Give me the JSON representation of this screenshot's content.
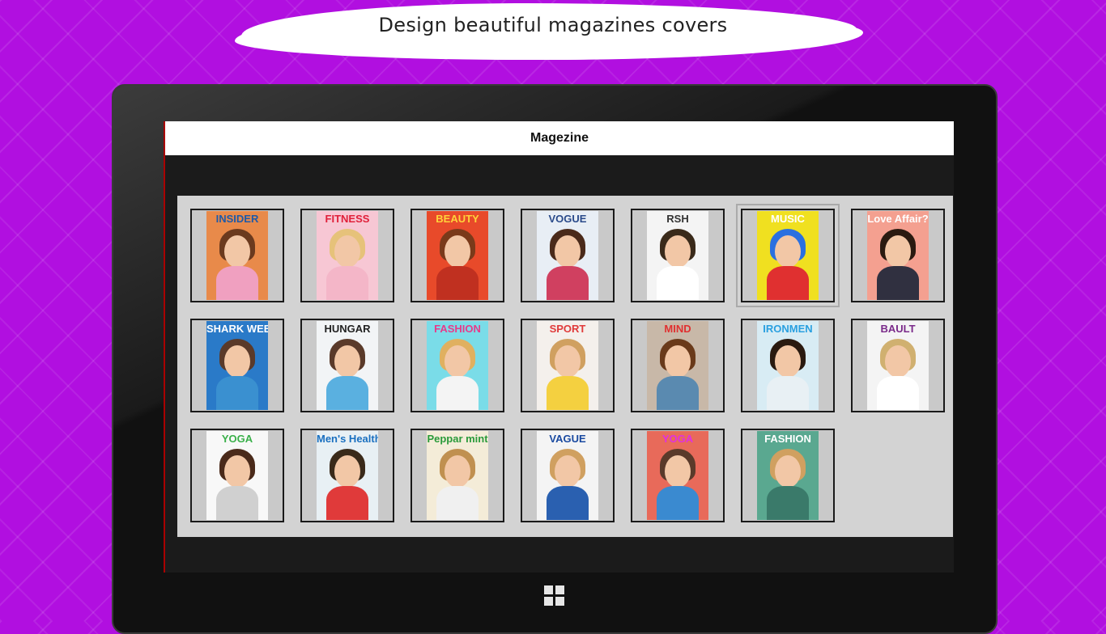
{
  "banner": {
    "text": "Design beautiful magazines covers"
  },
  "app": {
    "title": "Magezine"
  },
  "covers": [
    {
      "title": "INSIDER",
      "bg": "#e88a4a",
      "title_color": "#1e5aa8",
      "hair": "#6b3a1e",
      "cloth": "#f0a0c0"
    },
    {
      "title": "FITNESS",
      "bg": "#f7c7d4",
      "title_color": "#e0203a",
      "hair": "#e6c27a",
      "cloth": "#f4b6c8"
    },
    {
      "title": "BEAUTY",
      "bg": "#e84a2a",
      "title_color": "#ffd23a",
      "hair": "#7a3a1a",
      "cloth": "#c03020"
    },
    {
      "title": "VOGUE",
      "bg": "#e8eef5",
      "title_color": "#2a4a8a",
      "hair": "#4a2a1a",
      "cloth": "#d04060"
    },
    {
      "title": "RSH",
      "bg": "#f4f4f4",
      "title_color": "#333333",
      "hair": "#3a2a1a",
      "cloth": "#ffffff"
    },
    {
      "title": "MUSIC",
      "bg": "#f0e020",
      "title_color": "#ffffff",
      "hair": "#2a70e0",
      "cloth": "#e03030"
    },
    {
      "title": "Love Affair?",
      "bg": "#f4a090",
      "title_color": "#ffffff",
      "hair": "#2a1a10",
      "cloth": "#303040"
    },
    {
      "title": "SHARK WEEK",
      "bg": "#2a7ac8",
      "title_color": "#ffffff",
      "hair": "#5a3a2a",
      "cloth": "#3a90d0"
    },
    {
      "title": "HUNGAR",
      "bg": "#f2f4f6",
      "title_color": "#222222",
      "hair": "#5a3a2a",
      "cloth": "#5ab0e0"
    },
    {
      "title": "FASHION",
      "bg": "#7adce8",
      "title_color": "#e83a8a",
      "hair": "#e0b060",
      "cloth": "#f4f4f4"
    },
    {
      "title": "SPORT",
      "bg": "#f4f0ec",
      "title_color": "#e03a3a",
      "hair": "#d0a060",
      "cloth": "#f4d040"
    },
    {
      "title": "MIND",
      "bg": "#c8b8a8",
      "title_color": "#e03030",
      "hair": "#6a3a1a",
      "cloth": "#5a8ab0"
    },
    {
      "title": "IRONMEN",
      "bg": "#d8ecf4",
      "title_color": "#2aa0e0",
      "hair": "#2a1a10",
      "cloth": "#e8f0f4"
    },
    {
      "title": "BAULT",
      "bg": "#f4f4f4",
      "title_color": "#7a2a8a",
      "hair": "#d0b070",
      "cloth": "#ffffff"
    },
    {
      "title": "YOGA",
      "bg": "#f8f8f8",
      "title_color": "#3ab04a",
      "hair": "#4a2a1a",
      "cloth": "#d0d0d0"
    },
    {
      "title": "Men's Health",
      "bg": "#e8f0f4",
      "title_color": "#1a70c0",
      "hair": "#3a2a1a",
      "cloth": "#e03a3a"
    },
    {
      "title": "Peppar mint",
      "bg": "#f4ecd8",
      "title_color": "#2a9a3a",
      "hair": "#c09050",
      "cloth": "#f0f0f0"
    },
    {
      "title": "VAGUE",
      "bg": "#f4f4f4",
      "title_color": "#1a4aa0",
      "hair": "#d0a060",
      "cloth": "#2a60b0"
    },
    {
      "title": "YOGA",
      "bg": "#e86a5a",
      "title_color": "#e030e0",
      "hair": "#5a3a2a",
      "cloth": "#3a8ad0"
    },
    {
      "title": "FASHION",
      "bg": "#5aa890",
      "title_color": "#ffffff",
      "hair": "#d0a060",
      "cloth": "#3a7a6a"
    }
  ]
}
